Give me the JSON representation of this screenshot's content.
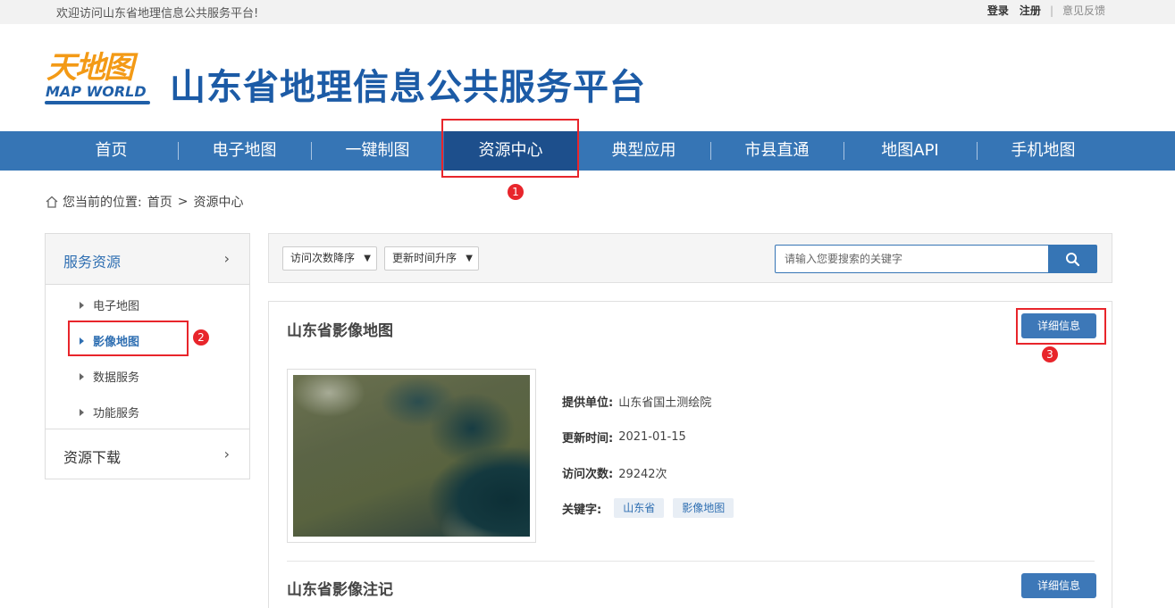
{
  "topbar": {
    "welcome": "欢迎访问山东省地理信息公共服务平台!",
    "login": "登录",
    "register": "注册",
    "separator": "|",
    "feedback": "意见反馈"
  },
  "header": {
    "logo_cn": "天地图",
    "logo_en": "MAP WORLD",
    "site_title": "山东省地理信息公共服务平台"
  },
  "nav": {
    "items": [
      "首页",
      "电子地图",
      "一键制图",
      "资源中心",
      "典型应用",
      "市县直通",
      "地图API",
      "手机地图"
    ],
    "active": "资源中心"
  },
  "breadcrumb": {
    "prefix": "您当前的位置:",
    "home": "首页",
    "sep": ">",
    "current": "资源中心"
  },
  "sidebar": {
    "section1": "服务资源",
    "items": [
      "电子地图",
      "影像地图",
      "数据服务",
      "功能服务"
    ],
    "active_item": "影像地图",
    "section2": "资源下载",
    "chevron": "›"
  },
  "toolbar": {
    "sort1": "访问次数降序",
    "sort2": "更新时间升序",
    "search_placeholder": "请输入您要搜索的关键字"
  },
  "resources": [
    {
      "title": "山东省影像地图",
      "detail_label": "详细信息",
      "provider_label": "提供单位:",
      "provider": "山东省国土测绘院",
      "updated_label": "更新时间:",
      "updated": "2021-01-15",
      "visits_label": "访问次数:",
      "visits": "29242次",
      "keywords_label": "关键字:",
      "keywords": [
        "山东省",
        "影像地图"
      ]
    },
    {
      "title": "山东省影像注记",
      "detail_label": "详细信息"
    }
  ],
  "annotations": [
    "1",
    "2",
    "3"
  ],
  "colors": {
    "nav_bg": "#3675b5",
    "nav_active": "#1d4f8c",
    "title_blue": "#1c5ba6",
    "annotation_red": "#e8252b"
  }
}
